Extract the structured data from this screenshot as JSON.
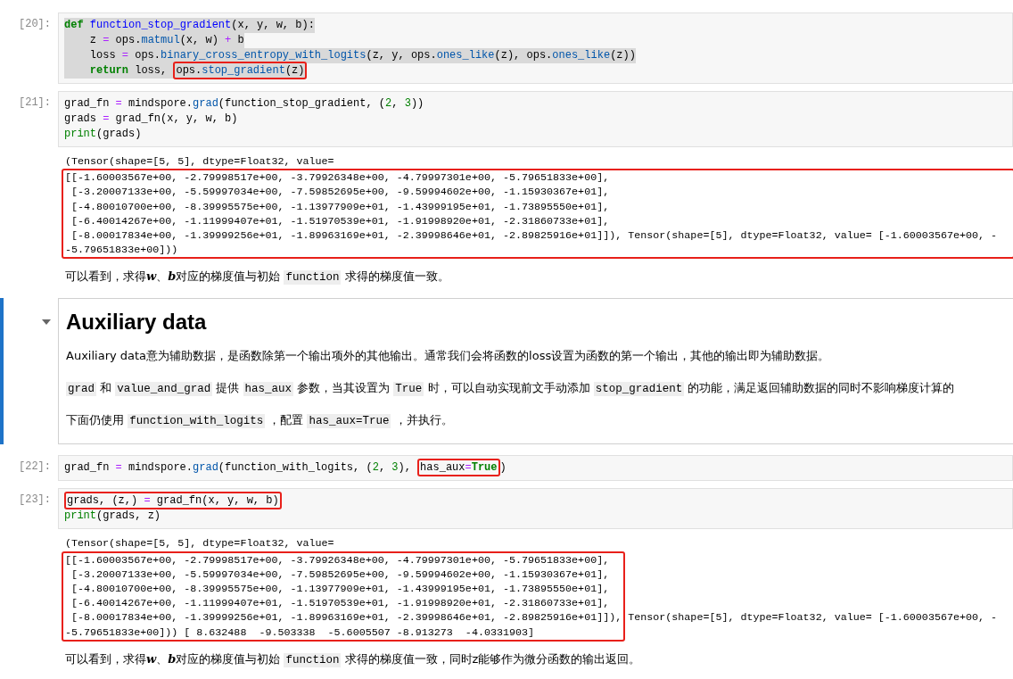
{
  "cells": [
    {
      "kind": "code",
      "prompt": "[20]:",
      "selected_text": true,
      "lines": [
        [
          {
            "t": "def ",
            "kind": "kw"
          },
          {
            "t": "function_stop_gradient",
            "kind": "fn"
          },
          {
            "t": "(x, y, w, b):",
            "kind": "p"
          }
        ],
        [
          {
            "t": "    z ",
            "kind": "p"
          },
          {
            "t": "=",
            "kind": "op"
          },
          {
            "t": " ops.",
            "kind": "p"
          },
          {
            "t": "matmul",
            "kind": "attr"
          },
          {
            "t": "(x, w) ",
            "kind": "p"
          },
          {
            "t": "+",
            "kind": "op"
          },
          {
            "t": " b",
            "kind": "p"
          }
        ],
        [
          {
            "t": "    loss ",
            "kind": "p"
          },
          {
            "t": "=",
            "kind": "op"
          },
          {
            "t": " ops.",
            "kind": "p"
          },
          {
            "t": "binary_cross_entropy_with_logits",
            "kind": "attr"
          },
          {
            "t": "(z, y, ops.",
            "kind": "p"
          },
          {
            "t": "ones_like",
            "kind": "attr"
          },
          {
            "t": "(z), ops.",
            "kind": "p"
          },
          {
            "t": "ones_like",
            "kind": "attr"
          },
          {
            "t": "(z))",
            "kind": "p"
          }
        ],
        [
          {
            "t": "    return",
            "kind": "kw"
          },
          {
            "t": " loss, ",
            "kind": "p"
          },
          {
            "boxed": [
              {
                "t": "ops.",
                "kind": "p"
              },
              {
                "t": "stop_gradient",
                "kind": "attr"
              },
              {
                "t": "(z)",
                "kind": "p"
              }
            ]
          }
        ]
      ]
    },
    {
      "kind": "code",
      "prompt": "[21]:",
      "selected_text": false,
      "lines": [
        [
          {
            "t": "grad_fn ",
            "kind": "p"
          },
          {
            "t": "=",
            "kind": "op"
          },
          {
            "t": " mindspore.",
            "kind": "p"
          },
          {
            "t": "grad",
            "kind": "attr"
          },
          {
            "t": "(function_stop_gradient, (",
            "kind": "p"
          },
          {
            "t": "2",
            "kind": "num"
          },
          {
            "t": ", ",
            "kind": "p"
          },
          {
            "t": "3",
            "kind": "num"
          },
          {
            "t": "))",
            "kind": "p"
          }
        ],
        [
          {
            "t": "grads ",
            "kind": "p"
          },
          {
            "t": "=",
            "kind": "op"
          },
          {
            "t": " grad_fn(x, y, w, b)",
            "kind": "p"
          }
        ],
        [
          {
            "t": "print",
            "kind": "builtin"
          },
          {
            "t": "(grads)",
            "kind": "p"
          }
        ]
      ]
    },
    {
      "kind": "output",
      "lines": [
        "(Tensor(shape=[5, 5], dtype=Float32, value="
      ],
      "box": {
        "kind": "wide",
        "lines": [
          "[[-1.60003567e+00, -2.79998517e+00, -3.79926348e+00, -4.79997301e+00, -5.79651833e+00],",
          " [-3.20007133e+00, -5.59997034e+00, -7.59852695e+00, -9.59994602e+00, -1.15930367e+01],",
          " [-4.80010700e+00, -8.39995575e+00, -1.13977909e+01, -1.43999195e+01, -1.73895550e+01],",
          " [-6.40014267e+00, -1.11999407e+01, -1.51970539e+01, -1.91998920e+01, -2.31860733e+01],",
          " [-8.00017834e+00, -1.39999256e+01, -1.89963169e+01, -2.39998646e+01, -2.89825916e+01]]), Tensor(shape=[5], dtype=Float32, value= [-1.60003567e+00, -",
          "-5.79651833e+00]))"
        ]
      }
    },
    {
      "kind": "markdown",
      "paragraphs": [
        [
          {
            "t": "可以看到，求得",
            "kind": "text"
          },
          {
            "t": "w",
            "kind": "math"
          },
          {
            "t": "、",
            "kind": "text"
          },
          {
            "t": "b",
            "kind": "math"
          },
          {
            "t": "对应的梯度值与初始 ",
            "kind": "text"
          },
          {
            "t": "function",
            "kind": "code"
          },
          {
            "t": " 求得的梯度值一致。",
            "kind": "text"
          }
        ]
      ]
    },
    {
      "kind": "heading",
      "selected": true,
      "expanded": true,
      "title": "Auxiliary data",
      "paragraphs": [
        [
          {
            "t": "Auxiliary data意为辅助数据，是函数除第一个输出项外的其他输出。通常我们会将函数的loss设置为函数的第一个输出，其他的输出即为辅助数据。",
            "kind": "text"
          }
        ],
        [
          {
            "t": "grad",
            "kind": "code"
          },
          {
            "t": " 和 ",
            "kind": "text"
          },
          {
            "t": "value_and_grad",
            "kind": "code"
          },
          {
            "t": " 提供 ",
            "kind": "text"
          },
          {
            "t": "has_aux",
            "kind": "code"
          },
          {
            "t": " 参数，当其设置为 ",
            "kind": "text"
          },
          {
            "t": "True",
            "kind": "code"
          },
          {
            "t": " 时，可以自动实现前文手动添加 ",
            "kind": "text"
          },
          {
            "t": "stop_gradient",
            "kind": "code"
          },
          {
            "t": " 的功能，满足返回辅助数据的同时不影响梯度计算的",
            "kind": "text"
          }
        ],
        [
          {
            "t": "下面仍使用 ",
            "kind": "text"
          },
          {
            "t": "function_with_logits",
            "kind": "code"
          },
          {
            "t": " ，配置 ",
            "kind": "text"
          },
          {
            "t": "has_aux=True",
            "kind": "code"
          },
          {
            "t": " ，并执行。",
            "kind": "text"
          }
        ]
      ]
    },
    {
      "kind": "code",
      "prompt": "[22]:",
      "selected_text": false,
      "lines": [
        [
          {
            "t": "grad_fn ",
            "kind": "p"
          },
          {
            "t": "=",
            "kind": "op"
          },
          {
            "t": " mindspore.",
            "kind": "p"
          },
          {
            "t": "grad",
            "kind": "attr"
          },
          {
            "t": "(function_with_logits, (",
            "kind": "p"
          },
          {
            "t": "2",
            "kind": "num"
          },
          {
            "t": ", ",
            "kind": "p"
          },
          {
            "t": "3",
            "kind": "num"
          },
          {
            "t": "), ",
            "kind": "p"
          },
          {
            "boxed": [
              {
                "t": "has_aux",
                "kind": "p"
              },
              {
                "t": "=",
                "kind": "op"
              },
              {
                "t": "True",
                "kind": "kw"
              }
            ]
          },
          {
            "t": ")",
            "kind": "p"
          }
        ]
      ]
    },
    {
      "kind": "code",
      "prompt": "[23]:",
      "selected_text": false,
      "lines": [
        [
          {
            "boxed": [
              {
                "t": "grads, (z,) ",
                "kind": "p"
              },
              {
                "t": "=",
                "kind": "op"
              },
              {
                "t": " grad_fn(x, y, w, b)",
                "kind": "p"
              }
            ]
          }
        ],
        [
          {
            "t": "print",
            "kind": "builtin"
          },
          {
            "t": "(grads, z)",
            "kind": "p"
          }
        ]
      ]
    },
    {
      "kind": "output",
      "lines": [
        "(Tensor(shape=[5, 5], dtype=Float32, value="
      ],
      "box": {
        "kind": "narrow",
        "lines": [
          "[[-1.60003567e+00, -2.79998517e+00, -3.79926348e+00, -4.79997301e+00, -5.79651833e+00],",
          " [-3.20007133e+00, -5.59997034e+00, -7.59852695e+00, -9.59994602e+00, -1.15930367e+01],",
          " [-4.80010700e+00, -8.39995575e+00, -1.13977909e+01, -1.43999195e+01, -1.73895550e+01],",
          " [-6.40014267e+00, -1.11999407e+01, -1.51970539e+01, -1.91998920e+01, -2.31860733e+01],",
          " [-8.00017834e+00, -1.39999256e+01, -1.89963169e+01, -2.39998646e+01, -2.89825916e+01]]), Tensor(shape=[5], dtype=Float32, value= [-1.60003567e+00, -",
          "-5.79651833e+00])) [ 8.632488  -9.503338  -5.6005507 -8.913273  -4.0331903]"
        ]
      }
    },
    {
      "kind": "markdown",
      "paragraphs": [
        [
          {
            "t": "可以看到，求得",
            "kind": "text"
          },
          {
            "t": "w",
            "kind": "math"
          },
          {
            "t": "、",
            "kind": "text"
          },
          {
            "t": "b",
            "kind": "math"
          },
          {
            "t": "对应的梯度值与初始 ",
            "kind": "text"
          },
          {
            "t": "function",
            "kind": "code"
          },
          {
            "t": " 求得的梯度值一致，同时z能够作为微分函数的输出返回。",
            "kind": "text"
          }
        ]
      ]
    }
  ]
}
